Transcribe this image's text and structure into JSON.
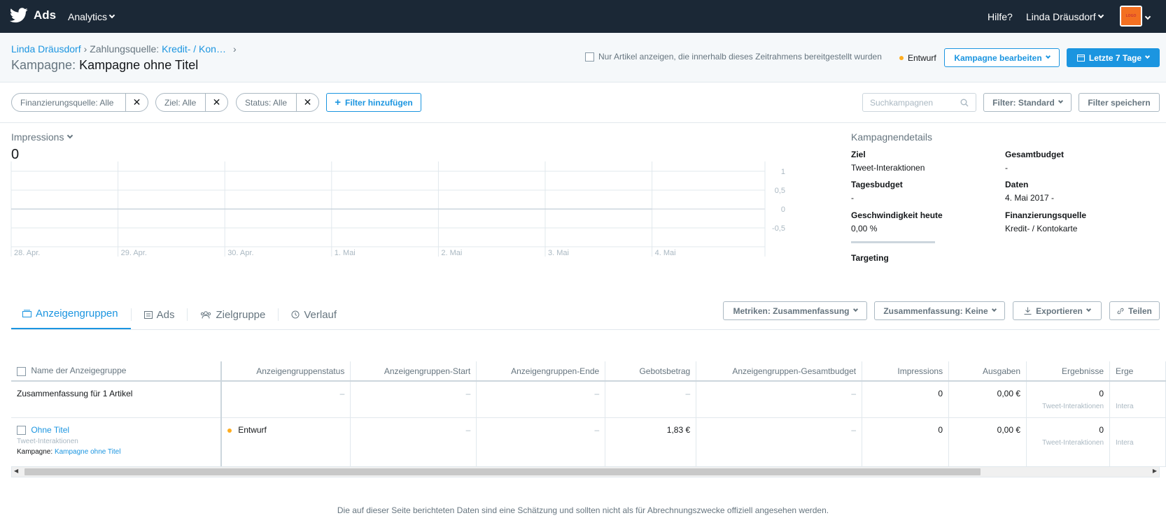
{
  "nav": {
    "brand": "Ads",
    "analytics": "Analytics",
    "help": "Hilfe?",
    "user": "Linda Dräusdorf",
    "logo_text": "LOGO"
  },
  "header": {
    "breadcrumb_account": "Linda Dräusdorf",
    "breadcrumb_funding_label": "Zahlungsquelle:",
    "breadcrumb_funding_value": "Kredit- / Kon…",
    "title_label": "Kampagne:",
    "title_value": "Kampagne ohne Titel",
    "only_items_checkbox": "Nur Artikel anzeigen, die innerhalb dieses Zeitrahmens bereitgestellt wurden",
    "status": "Entwurf",
    "edit_button": "Kampagne bearbeiten",
    "date_range_button": "Letzte 7 Tage"
  },
  "filters": {
    "pills": [
      {
        "label": "Finanzierungsquelle: Alle"
      },
      {
        "label": "Ziel: Alle"
      },
      {
        "label": "Status: Alle"
      }
    ],
    "add_filter": "Filter hinzufügen",
    "search_placeholder": "Suchkampagnen",
    "filter_standard": "Filter: Standard",
    "save_filter": "Filter speichern"
  },
  "metric": {
    "name": "Impressions",
    "value": "0"
  },
  "chart_data": {
    "type": "line",
    "x": [
      "28. Apr.",
      "29. Apr.",
      "30. Apr.",
      "1. Mai",
      "2. Mai",
      "3. Mai",
      "4. Mai"
    ],
    "series": [
      {
        "values": [
          0,
          0,
          0,
          0,
          0,
          0,
          0
        ]
      }
    ],
    "y_ticks": [
      "1",
      "0,5",
      "0",
      "-0,5"
    ],
    "ylim": [
      -1,
      1
    ],
    "grid": true
  },
  "details": {
    "title": "Kampagnendetails",
    "items": [
      {
        "key": "Ziel",
        "value": "Tweet-Interaktionen"
      },
      {
        "key": "Gesamtbudget",
        "value": "-"
      },
      {
        "key": "Tagesbudget",
        "value": "-"
      },
      {
        "key": "Daten",
        "value": "4. Mai 2017 -"
      },
      {
        "key": "Geschwindigkeit heute",
        "value": "0,00 %"
      },
      {
        "key": "Finanzierungsquelle",
        "value": "Kredit- / Kontokarte"
      },
      {
        "key": "Targeting",
        "value": ""
      }
    ]
  },
  "tabs": {
    "items": [
      {
        "label": "Anzeigengruppen"
      },
      {
        "label": "Ads"
      },
      {
        "label": "Zielgruppe"
      },
      {
        "label": "Verlauf"
      }
    ],
    "metrics_button": "Metriken: Zusammenfassung",
    "summary_button": "Zusammenfassung: Keine",
    "export_button": "Exportieren",
    "share_button": "Teilen"
  },
  "table": {
    "headers": [
      "Name der Anzeigegruppe",
      "Anzeigengruppenstatus",
      "Anzeigengruppen-Start",
      "Anzeigengruppen-Ende",
      "Gebotsbetrag",
      "Anzeigengruppen-Gesamtbudget",
      "Impressions",
      "Ausgaben",
      "Ergebnisse",
      "Erge"
    ],
    "summary": {
      "name": "Zusammenfassung für 1 Artikel",
      "status": "–",
      "start": "–",
      "end": "–",
      "bid": "–",
      "budget": "–",
      "impressions": "0",
      "spend": "0,00 €",
      "results": "0",
      "results_sub": "Tweet-Interaktionen",
      "results2_sub": "Intera"
    },
    "row": {
      "name": "Ohne Titel",
      "name_sub": "Tweet-Interaktionen",
      "campaign_label": "Kampagne:",
      "campaign_value": "Kampagne ohne Titel",
      "status": "Entwurf",
      "start": "–",
      "end": "–",
      "bid": "1,83 €",
      "budget": "–",
      "impressions": "0",
      "spend": "0,00 €",
      "results": "0",
      "results_sub": "Tweet-Interaktionen",
      "results2_sub": "Intera"
    }
  },
  "footer": "Die auf dieser Seite berichteten Daten sind eine Schätzung und sollten nicht als für Abrechnungszwecke offiziell angesehen werden.",
  "colors": {
    "nav_bg": "#1b2836",
    "accent": "#1b95e0",
    "draft": "#ffad1f"
  }
}
